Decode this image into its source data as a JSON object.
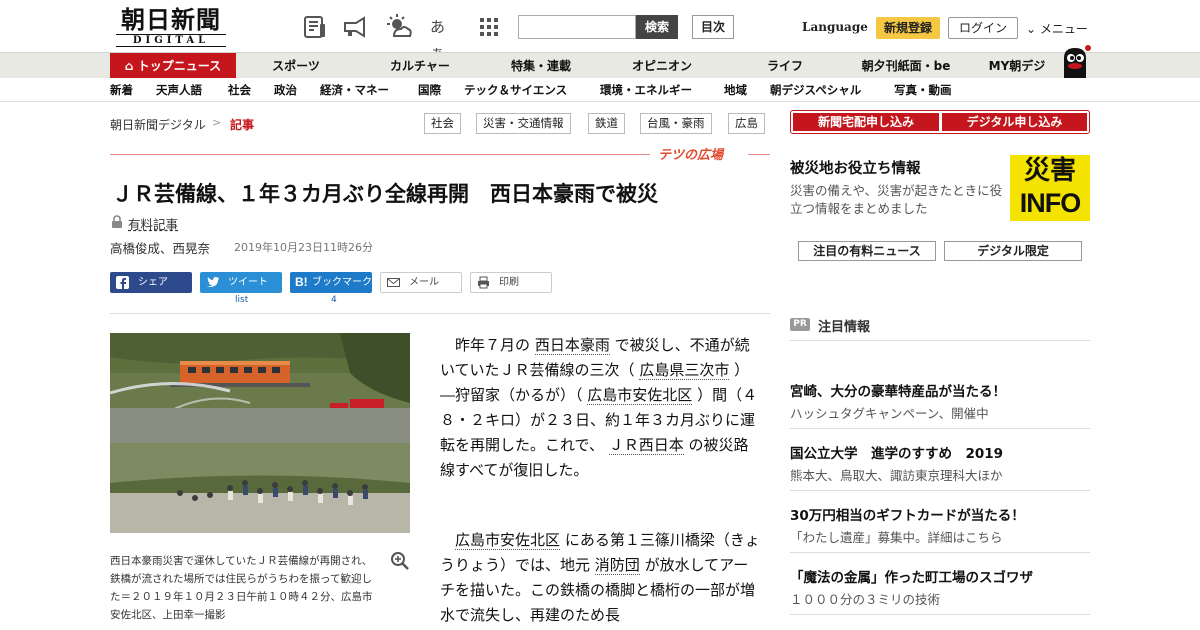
{
  "header": {
    "logo_jp": "朝日新聞",
    "logo_en": "DIGITAL",
    "icons": [
      "newspaper-icon",
      "megaphone-icon",
      "weather-icon",
      "text-size-icon",
      "grid-icon"
    ],
    "text_size_label": "あぁ",
    "search_placeholder": "",
    "search_button": "検索",
    "toc_button": "目次",
    "language": "Language",
    "register": "新規登録",
    "login": "ログイン",
    "menu": "メニュー"
  },
  "nav1": [
    "トップニュース",
    "スポーツ",
    "カルチャー",
    "特集・連載",
    "オピニオン",
    "ライフ",
    "朝夕刊紙面・be",
    "MY朝デジ"
  ],
  "nav2": [
    "新着",
    "天声人語",
    "社会",
    "政治",
    "経済・マネー",
    "国際",
    "テック＆サイエンス",
    "環境・エネルギー",
    "地域",
    "朝デジスペシャル",
    "写真・動画"
  ],
  "breadcrumb": {
    "root": "朝日新聞デジタル",
    "sep": ">",
    "current": "記事"
  },
  "tags": [
    "社会",
    "災害・交通情報",
    "鉄道",
    "台風・豪雨",
    "広島"
  ],
  "section_name": "テツの広場",
  "article": {
    "headline": "ＪＲ芸備線、１年３カ月ぶり全線再開　西日本豪雨で被災",
    "paid_label": "有料記事",
    "byline": "高橋俊成、西晃奈",
    "date": "2019年10月23日11時26分",
    "share": {
      "facebook": "シェア",
      "twitter": "ツイート",
      "hatena": "ブックマーク",
      "mail": "メール",
      "print": "印刷",
      "twitter_count": "list",
      "hatena_count": "4"
    },
    "caption": "西日本豪雨災害で運休していたＪＲ芸備線が再開され、鉄橋が流された場所では住民らがうちわを振って歓迎した＝２０１９年１０月２３日午前１０時４２分、広島市安佐北区、上田幸一撮影",
    "p1": {
      "a": "昨年７月の",
      "l1": "西日本豪雨",
      "b": "で被災し、不通が続いていたＪＲ芸備線の三次（",
      "l2": "広島県三次市",
      "c": "）―狩留家（かるが）（",
      "l3": "広島市安佐北区",
      "d": "）間（４８・２キロ）が２３日、約１年３カ月ぶりに運転を再開した。これで、",
      "l4": "ＪＲ西日本",
      "e": "の被災路線すべてが復旧した。"
    },
    "p2": {
      "l1": "広島市安佐北区",
      "a": "にある第１三篠川橋梁（きょうりょう）では、地元",
      "l2": "消防団",
      "b": "が放水してアーチを描いた。この鉄橋の橋脚と橋桁の一部が増水で流失し、再建のため長"
    }
  },
  "sidebar": {
    "buttons": [
      "新聞宅配申し込み",
      "デジタル申し込み"
    ],
    "disaster_title": "被災地お役立ち情報",
    "disaster_desc": "災害の備えや、災害が起きたときに役立つ情報をまとめました",
    "info_kanji": "災害",
    "info_en": "INFO",
    "pick_buttons": [
      "注目の有料ニュース",
      "デジタル限定"
    ],
    "pr_badge": "PR",
    "pr_label": "注目情報",
    "pr_items": [
      {
        "title": "宮崎、大分の豪華特産品が当たる！",
        "sub": "ハッシュタグキャンペーン、開催中"
      },
      {
        "title": "国公立大学　進学のすすめ　2019",
        "sub": "熊本大、鳥取大、諏訪東京理科大ほか"
      },
      {
        "title": "30万円相当のギフトカードが当たる！",
        "sub": "「わたし遺産」募集中。詳細はこちら"
      },
      {
        "title": "「魔法の金属」作った町工場のスゴワザ",
        "sub": "１０００分の３ミリの技術"
      }
    ]
  }
}
